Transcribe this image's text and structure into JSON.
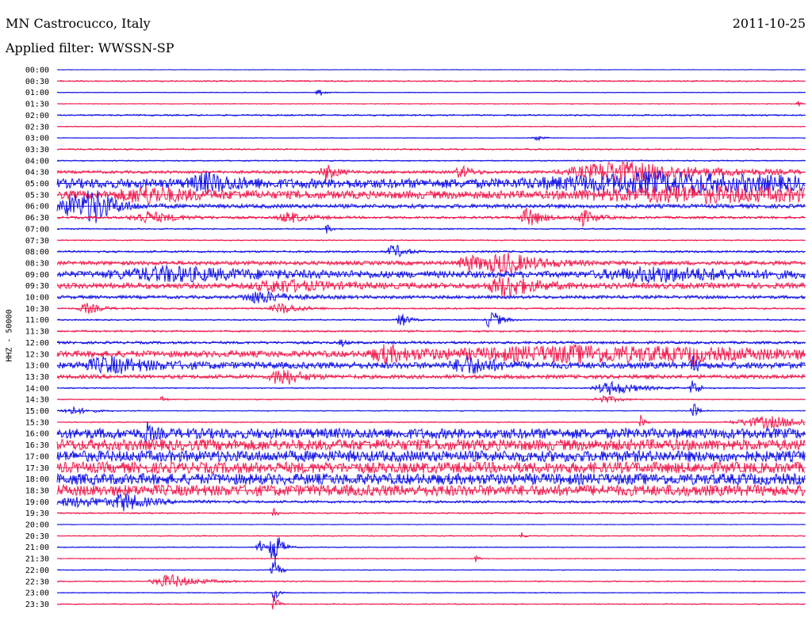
{
  "header": {
    "station": "MN Castrocucco, Italy",
    "date": "2011-10-25",
    "filter": "Applied filter: WWSSN-SP"
  },
  "colors": {
    "even_trace": "#1414e6",
    "odd_trace": "#f01e50"
  },
  "chart_data": {
    "type": "line",
    "title": "MN Castrocucco, Italy",
    "subtitle": "Applied filter: WWSSN-SP",
    "ylabel": "HHZ - 50000",
    "xlabel": "",
    "tick_labels": [
      "00:00",
      "00:30",
      "01:00",
      "01:30",
      "02:00",
      "02:30",
      "03:00",
      "03:30",
      "04:00",
      "04:30",
      "05:00",
      "05:30",
      "06:00",
      "06:30",
      "07:00",
      "07:30",
      "08:00",
      "08:30",
      "09:00",
      "09:30",
      "10:00",
      "10:30",
      "11:00",
      "11:30",
      "12:00",
      "12:30",
      "13:00",
      "13:30",
      "14:00",
      "14:30",
      "15:00",
      "15:30",
      "16:00",
      "16:30",
      "17:00",
      "17:30",
      "18:00",
      "18:30",
      "19:00",
      "19:30",
      "20:00",
      "20:30",
      "21:00",
      "21:30",
      "22:00",
      "22:30",
      "23:00",
      "23:30"
    ],
    "series": [
      {
        "label": "00:00",
        "noise": 0.3,
        "events": []
      },
      {
        "label": "00:30",
        "noise": 0.8,
        "events": []
      },
      {
        "label": "01:00",
        "noise": 0.4,
        "events": [
          {
            "x": 0.35,
            "amp": 6,
            "w": 0.006
          }
        ]
      },
      {
        "label": "01:30",
        "noise": 0.5,
        "events": [
          {
            "x": 0.99,
            "amp": 3,
            "w": 0.004
          }
        ]
      },
      {
        "label": "02:00",
        "noise": 0.9,
        "events": []
      },
      {
        "label": "02:30",
        "noise": 0.5,
        "events": []
      },
      {
        "label": "03:00",
        "noise": 0.4,
        "events": [
          {
            "x": 0.64,
            "amp": 4,
            "w": 0.007
          }
        ]
      },
      {
        "label": "03:30",
        "noise": 0.9,
        "events": []
      },
      {
        "label": "04:00",
        "noise": 0.7,
        "events": []
      },
      {
        "label": "04:30",
        "noise": 1.8,
        "events": [
          {
            "x": 0.36,
            "amp": 10,
            "w": 0.012
          },
          {
            "x": 0.54,
            "amp": 8,
            "w": 0.012
          },
          {
            "x": 0.75,
            "amp": 14,
            "w": 0.09
          }
        ]
      },
      {
        "label": "05:00",
        "noise": 6,
        "events": [
          {
            "x": 0.2,
            "amp": 10,
            "w": 0.03
          },
          {
            "x": 0.8,
            "amp": 10,
            "w": 0.2
          }
        ]
      },
      {
        "label": "05:30",
        "noise": 5,
        "events": [
          {
            "x": 0.12,
            "amp": 9,
            "w": 0.05
          },
          {
            "x": 0.85,
            "amp": 8,
            "w": 0.2
          }
        ]
      },
      {
        "label": "06:00",
        "noise": 2.5,
        "events": [
          {
            "x": 0.02,
            "amp": 14,
            "w": 0.03
          },
          {
            "x": 0.05,
            "amp": 18,
            "w": 0.02
          }
        ]
      },
      {
        "label": "06:30",
        "noise": 1.5,
        "events": [
          {
            "x": 0.12,
            "amp": 8,
            "w": 0.03
          },
          {
            "x": 0.31,
            "amp": 7,
            "w": 0.02
          },
          {
            "x": 0.63,
            "amp": 13,
            "w": 0.015
          },
          {
            "x": 0.7,
            "amp": 11,
            "w": 0.015
          }
        ]
      },
      {
        "label": "07:00",
        "noise": 0.8,
        "events": [
          {
            "x": 0.36,
            "amp": 6,
            "w": 0.005
          }
        ]
      },
      {
        "label": "07:30",
        "noise": 0.7,
        "events": []
      },
      {
        "label": "08:00",
        "noise": 1.2,
        "events": [
          {
            "x": 0.45,
            "amp": 10,
            "w": 0.012
          }
        ]
      },
      {
        "label": "08:30",
        "noise": 2.5,
        "events": [
          {
            "x": 0.55,
            "amp": 10,
            "w": 0.02
          },
          {
            "x": 0.6,
            "amp": 12,
            "w": 0.04
          }
        ]
      },
      {
        "label": "09:00",
        "noise": 4,
        "events": [
          {
            "x": 0.15,
            "amp": 8,
            "w": 0.1
          },
          {
            "x": 0.8,
            "amp": 8,
            "w": 0.1
          }
        ]
      },
      {
        "label": "09:30",
        "noise": 3.5,
        "events": [
          {
            "x": 0.6,
            "amp": 14,
            "w": 0.03
          },
          {
            "x": 0.3,
            "amp": 7,
            "w": 0.05
          }
        ]
      },
      {
        "label": "10:00",
        "noise": 2,
        "events": [
          {
            "x": 0.27,
            "amp": 8,
            "w": 0.03
          }
        ]
      },
      {
        "label": "10:30",
        "noise": 1,
        "events": [
          {
            "x": 0.04,
            "amp": 7,
            "w": 0.015
          },
          {
            "x": 0.3,
            "amp": 7,
            "w": 0.02
          }
        ]
      },
      {
        "label": "11:00",
        "noise": 0.8,
        "events": [
          {
            "x": 0.46,
            "amp": 10,
            "w": 0.008
          },
          {
            "x": 0.58,
            "amp": 14,
            "w": 0.01
          }
        ]
      },
      {
        "label": "11:30",
        "noise": 1.1,
        "events": []
      },
      {
        "label": "12:00",
        "noise": 1.6,
        "events": [
          {
            "x": 0.38,
            "amp": 6,
            "w": 0.004
          }
        ]
      },
      {
        "label": "12:30",
        "noise": 4,
        "events": [
          {
            "x": 0.44,
            "amp": 10,
            "w": 0.03
          },
          {
            "x": 0.7,
            "amp": 9,
            "w": 0.25
          },
          {
            "x": 0.85,
            "amp": 12,
            "w": 0.005
          }
        ]
      },
      {
        "label": "13:00",
        "noise": 4,
        "events": [
          {
            "x": 0.07,
            "amp": 9,
            "w": 0.05
          },
          {
            "x": 0.55,
            "amp": 10,
            "w": 0.03
          },
          {
            "x": 0.85,
            "amp": 10,
            "w": 0.005
          }
        ]
      },
      {
        "label": "13:30",
        "noise": 2.5,
        "events": [
          {
            "x": 0.3,
            "amp": 12,
            "w": 0.02
          }
        ]
      },
      {
        "label": "14:00",
        "noise": 0.7,
        "events": [
          {
            "x": 0.74,
            "amp": 9,
            "w": 0.03
          },
          {
            "x": 0.85,
            "amp": 14,
            "w": 0.006
          }
        ]
      },
      {
        "label": "14:30",
        "noise": 0.6,
        "events": [
          {
            "x": 0.14,
            "amp": 5,
            "w": 0.004
          },
          {
            "x": 0.73,
            "amp": 6,
            "w": 0.015
          }
        ]
      },
      {
        "label": "15:00",
        "noise": 0.5,
        "events": [
          {
            "x": 0.02,
            "amp": 5,
            "w": 0.02
          },
          {
            "x": 0.85,
            "amp": 12,
            "w": 0.005
          }
        ]
      },
      {
        "label": "15:30",
        "noise": 0.6,
        "events": [
          {
            "x": 0.78,
            "amp": 10,
            "w": 0.004
          },
          {
            "x": 0.95,
            "amp": 8,
            "w": 0.06
          }
        ]
      },
      {
        "label": "16:00",
        "noise": 6.5,
        "events": [
          {
            "x": 0.12,
            "amp": 10,
            "w": 0.006
          }
        ]
      },
      {
        "label": "16:30",
        "noise": 7,
        "events": []
      },
      {
        "label": "17:00",
        "noise": 7,
        "events": []
      },
      {
        "label": "17:30",
        "noise": 7,
        "events": []
      },
      {
        "label": "18:00",
        "noise": 7,
        "events": []
      },
      {
        "label": "18:30",
        "noise": 7,
        "events": []
      },
      {
        "label": "19:00",
        "noise": 1.5,
        "events": [
          {
            "x": 0.03,
            "amp": 6,
            "w": 0.06
          },
          {
            "x": 0.09,
            "amp": 10,
            "w": 0.02
          }
        ]
      },
      {
        "label": "19:30",
        "noise": 0.8,
        "events": [
          {
            "x": 0.29,
            "amp": 8,
            "w": 0.003
          }
        ]
      },
      {
        "label": "20:00",
        "noise": 0.4,
        "events": []
      },
      {
        "label": "20:30",
        "noise": 0.6,
        "events": [
          {
            "x": 0.62,
            "amp": 5,
            "w": 0.003
          }
        ]
      },
      {
        "label": "21:00",
        "noise": 0.5,
        "events": [
          {
            "x": 0.27,
            "amp": 10,
            "w": 0.005
          },
          {
            "x": 0.29,
            "amp": 26,
            "w": 0.008
          }
        ]
      },
      {
        "label": "21:30",
        "noise": 0.5,
        "events": [
          {
            "x": 0.56,
            "amp": 5,
            "w": 0.003
          }
        ]
      },
      {
        "label": "22:00",
        "noise": 0.5,
        "events": [
          {
            "x": 0.29,
            "amp": 14,
            "w": 0.006
          }
        ]
      },
      {
        "label": "22:30",
        "noise": 0.7,
        "events": [
          {
            "x": 0.15,
            "amp": 9,
            "w": 0.03
          }
        ]
      },
      {
        "label": "23:00",
        "noise": 0.5,
        "events": [
          {
            "x": 0.29,
            "amp": 12,
            "w": 0.004
          }
        ]
      },
      {
        "label": "23:30",
        "noise": 0.6,
        "events": [
          {
            "x": 0.29,
            "amp": 14,
            "w": 0.004
          }
        ]
      }
    ]
  }
}
